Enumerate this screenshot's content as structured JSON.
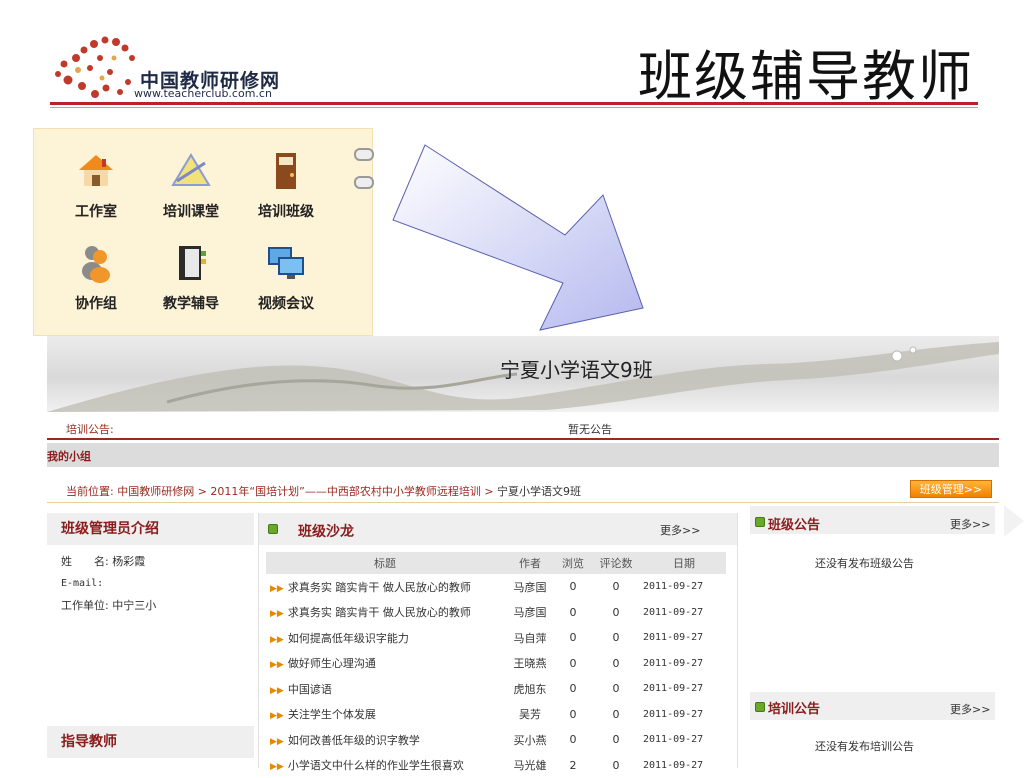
{
  "header": {
    "logo_text": "中国教师研修网",
    "logo_url": "www.teacherclub.com.cn",
    "slide_title": "班级辅导教师"
  },
  "icons": [
    {
      "label": "工作室",
      "icon": "house-icon"
    },
    {
      "label": "培训课堂",
      "icon": "triangle-ruler-icon"
    },
    {
      "label": "培训班级",
      "icon": "door-icon"
    },
    {
      "label": "协作组",
      "icon": "people-icon"
    },
    {
      "label": "教学辅导",
      "icon": "notebook-icon"
    },
    {
      "label": "视频会议",
      "icon": "monitors-icon"
    }
  ],
  "page": {
    "banner_title": "宁夏小学语文9班",
    "notice_label": "培训公告:",
    "notice_text": "暂无公告",
    "group_label": "我的小组",
    "breadcrumb_prefix": "当前位置:",
    "breadcrumb_path": "中国教师研修网 > 2011年“国培计划”——中西部农村中小学教师远程培训 > ",
    "breadcrumb_current": "宁夏小学语文9班",
    "manage_button": "班级管理>>",
    "admin": {
      "title": "班级管理员介绍",
      "name_label": "姓　　名:",
      "name": "杨彩霞",
      "email_label": "E-mail:",
      "email": "",
      "unit_label": "工作单位:",
      "unit": "中宁三小"
    },
    "mentor_title": "指导教师",
    "salon": {
      "title": "班级沙龙",
      "more": "更多>>",
      "columns": [
        "标题",
        "作者",
        "浏览",
        "评论数",
        "日期"
      ],
      "rows": [
        {
          "title": "求真务实 踏实肯干 做人民放心的教师",
          "author": "马彦国",
          "views": "0",
          "comments": "0",
          "date": "2011-09-27"
        },
        {
          "title": "求真务实 踏实肯干 做人民放心的教师",
          "author": "马彦国",
          "views": "0",
          "comments": "0",
          "date": "2011-09-27"
        },
        {
          "title": "如何提高低年级识字能力",
          "author": "马自萍",
          "views": "0",
          "comments": "0",
          "date": "2011-09-27"
        },
        {
          "title": "做好师生心理沟通",
          "author": "王晓燕",
          "views": "0",
          "comments": "0",
          "date": "2011-09-27"
        },
        {
          "title": "中国谚语",
          "author": "虎旭东",
          "views": "0",
          "comments": "0",
          "date": "2011-09-27"
        },
        {
          "title": "关注学生个体发展",
          "author": "吴芳",
          "views": "0",
          "comments": "0",
          "date": "2011-09-27"
        },
        {
          "title": "如何改善低年级的识字教学",
          "author": "买小燕",
          "views": "0",
          "comments": "0",
          "date": "2011-09-27"
        },
        {
          "title": "小学语文中什么样的作业学生很喜欢",
          "author": "马光雄",
          "views": "2",
          "comments": "0",
          "date": "2011-09-27"
        }
      ]
    },
    "class_notice": {
      "title": "班级公告",
      "more": "更多>>",
      "empty": "还没有发布班级公告"
    },
    "train_notice": {
      "title": "培训公告",
      "more": "更多>>",
      "empty": "还没有发布培训公告"
    }
  },
  "colors": {
    "accent": "#8a1c1c",
    "header_rule": "#b8232a",
    "button": "#f08200",
    "panel": "#fdf3d6",
    "arrow_fill": "#c9ccf2"
  }
}
